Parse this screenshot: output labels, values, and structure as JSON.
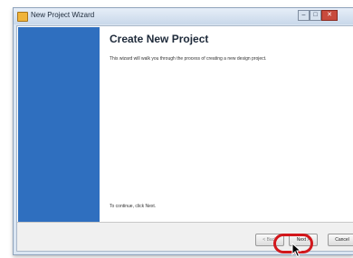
{
  "window": {
    "title": "New Project Wizard"
  },
  "page": {
    "heading": "Create New Project",
    "description": "This wizard will walk you through the process of creating a new design project.",
    "footer_note": "To continue, click Next."
  },
  "buttons": {
    "back": "< Back",
    "next": "Next >",
    "cancel": "Cancel"
  },
  "annotation": {
    "highlight_color": "#d2171b"
  },
  "colors": {
    "sidebar": "#2f6fbf"
  }
}
